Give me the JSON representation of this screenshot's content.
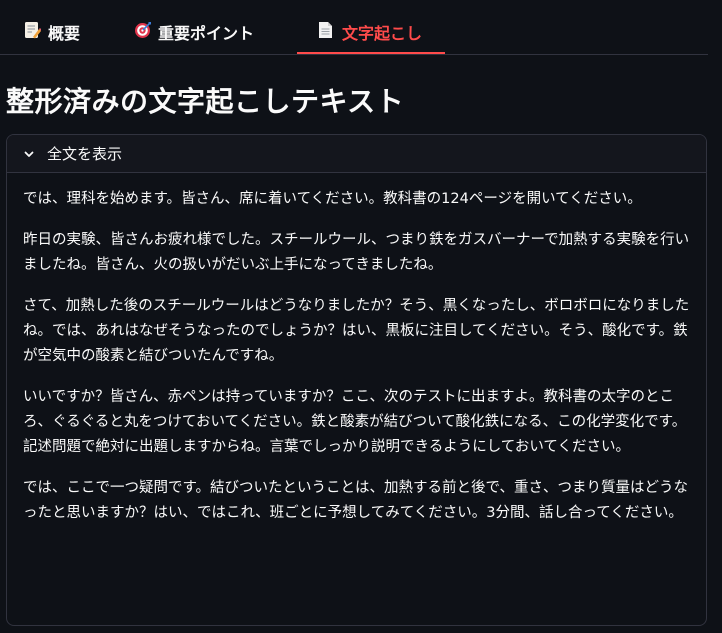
{
  "tabs": [
    {
      "label": "概要",
      "icon": "memo-icon"
    },
    {
      "label": "重要ポイント",
      "icon": "target-icon"
    },
    {
      "label": "文字起こし",
      "icon": "document-icon"
    }
  ],
  "active_tab": 2,
  "page_title": "整形済みの文字起こしテキスト",
  "expander": {
    "label": "全文を表示",
    "paragraphs": [
      "では、理科を始めます。皆さん、席に着いてください。教科書の124ページを開いてください。",
      "昨日の実験、皆さんお疲れ様でした。スチールウール、つまり鉄をガスバーナーで加熱する実験を行いましたね。皆さん、火の扱いがだいぶ上手になってきましたね。",
      "さて、加熱した後のスチールウールはどうなりましたか？そう、黒くなったし、ボロボロになりましたね。では、あれはなぜそうなったのでしょうか？はい、黒板に注目してください。そう、酸化です。鉄が空気中の酸素と結びついたんですね。",
      "いいですか？皆さん、赤ペンは持っていますか？ここ、次のテストに出ますよ。教科書の太字のところ、ぐるぐると丸をつけておいてください。鉄と酸素が結びついて酸化鉄になる、この化学変化です。記述問題で絶対に出題しますからね。言葉でしっかり説明できるようにしておいてください。",
      "では、ここで一つ疑問です。結びついたということは、加熱する前と後で、重さ、つまり質量はどうなったと思いますか？はい、ではこれ、班ごとに予想してみてください。3分間、話し合ってください。"
    ]
  },
  "colors": {
    "background": "#0e1117",
    "accent": "#ff4b4b",
    "border": "#31333f",
    "text": "#fafafa"
  }
}
